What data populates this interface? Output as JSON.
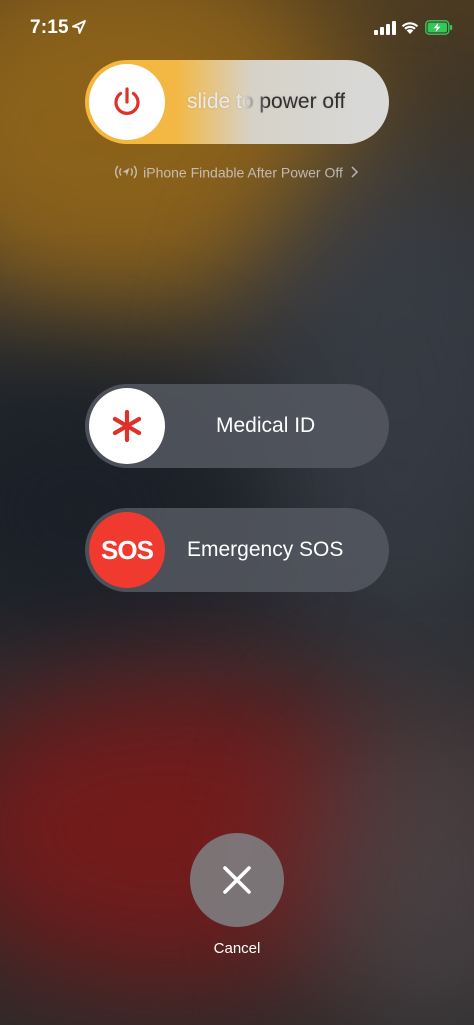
{
  "status_bar": {
    "time": "7:15",
    "icons": [
      "location-arrow-icon",
      "cellular-signal-icon",
      "wifi-icon",
      "battery-charging-icon"
    ],
    "battery_color": "#34c759"
  },
  "power_slider": {
    "label": "slide to power off",
    "icon": "power-icon",
    "icon_color": "#e0302a"
  },
  "findable": {
    "text": "iPhone Findable After Power Off",
    "icon": "find-my-icon",
    "chevron": "chevron-right-icon"
  },
  "medical_slider": {
    "label": "Medical ID",
    "icon": "medical-asterisk-icon",
    "icon_color": "#e0302a"
  },
  "sos_slider": {
    "label": "Emergency SOS",
    "knob_text": "SOS",
    "knob_color": "#f03a2f"
  },
  "cancel": {
    "label": "Cancel",
    "icon": "close-icon"
  }
}
